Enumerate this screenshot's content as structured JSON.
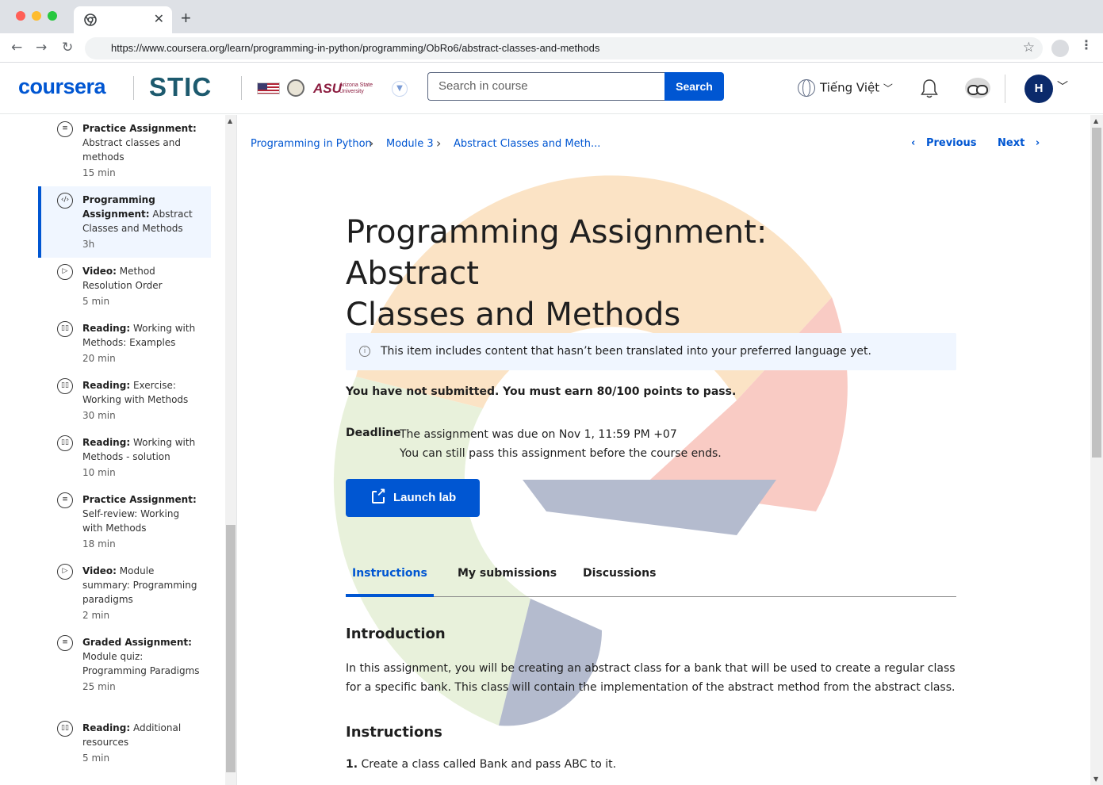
{
  "browser": {
    "tab_title": "",
    "url": "https://www.coursera.org/learn/programming-in-python/programming/ObRo6/abstract-classes-and-methods",
    "new_tab_label": "+",
    "close_label": "✕"
  },
  "header": {
    "coursera_logo": "coursera",
    "stic_logo": "STIC",
    "asu_logo": "ASU",
    "asu_sub": "Arizona State University",
    "search": {
      "placeholder": "Search in course",
      "button_label": "Search"
    },
    "language": "Tiếng Việt",
    "avatar_initial": "H"
  },
  "sidebar": {
    "items": [
      {
        "kind": "Practice Assignment:",
        "title": "Abstract classes and methods",
        "duration": "15 min",
        "icon": "assignment-icon"
      },
      {
        "kind": "Programming Assignment:",
        "title": "Abstract Classes and Methods",
        "duration": "3h",
        "icon": "code-icon",
        "active": true
      },
      {
        "kind": "Video:",
        "title": "Method Resolution Order",
        "duration": "5 min",
        "icon": "play-icon"
      },
      {
        "kind": "Reading:",
        "title": "Working with Methods: Examples",
        "duration": "20 min",
        "icon": "reading-icon"
      },
      {
        "kind": "Reading:",
        "title": "Exercise: Working with Methods",
        "duration": "30 min",
        "icon": "reading-icon"
      },
      {
        "kind": "Reading:",
        "title": "Working with Methods - solution",
        "duration": "10 min",
        "icon": "reading-icon"
      },
      {
        "kind": "Practice Assignment:",
        "title": "Self-review: Working with Methods",
        "duration": "18 min",
        "icon": "assignment-icon"
      },
      {
        "kind": "Video:",
        "title": "Module summary: Programming paradigms",
        "duration": "2 min",
        "icon": "play-icon"
      },
      {
        "kind": "Graded Assignment:",
        "title": "Module quiz: Programming Paradigms",
        "duration": "25 min",
        "icon": "assignment-icon"
      },
      {
        "kind": "Reading:",
        "title": "Additional resources",
        "duration": "5 min",
        "icon": "reading-icon"
      }
    ]
  },
  "main": {
    "breadcrumb": [
      "Programming in Python",
      "Module 3",
      "Abstract Classes and Meth..."
    ],
    "previous_label": "Previous",
    "next_label": "Next",
    "title_line1": "Programming Assignment: Abstract",
    "title_line2": "Classes and Methods",
    "notice": "This item includes content that hasn’t been translated into your preferred language yet.",
    "submission_status": "You have not submitted. You must earn 80/100 points to pass.",
    "deadline_label": "Deadline",
    "deadline_line1": "The assignment was due on Nov 1, 11:59 PM +07",
    "deadline_line2": "You can still pass this assignment before the course ends.",
    "launch_label": "Launch lab",
    "tabs": [
      "Instructions",
      "My submissions",
      "Discussions"
    ],
    "active_tab": "Instructions",
    "intro_heading": "Introduction",
    "intro_text": "In this assignment, you will be creating an abstract class for a bank that will be used to create a regular class for a specific bank. This class will contain the implementation of the abstract method from the abstract class.",
    "instructions_heading": "Instructions",
    "step1_num": "1.",
    "step1_text": " Create a class called Bank and pass ABC to it."
  },
  "colors": {
    "brand_blue": "#0056d2",
    "stic_teal": "#1d5a6e",
    "asu_maroon": "#8c1d40",
    "notice_bg": "#f0f6ff"
  }
}
